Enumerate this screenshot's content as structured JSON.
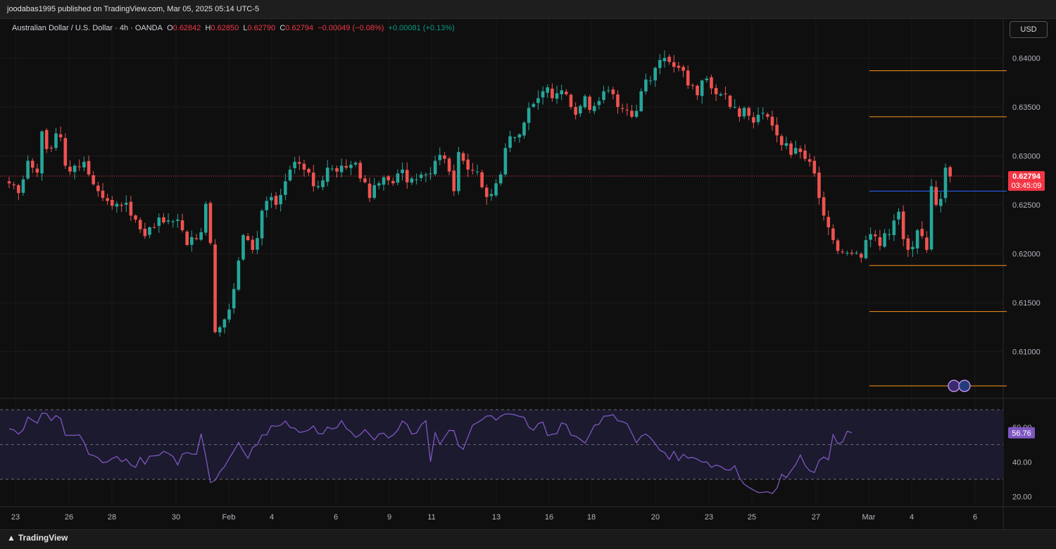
{
  "header": {
    "publisher_line": "joodabas1995 published on TradingView.com, Mar 05, 2025 05:14 UTC-5"
  },
  "legend": {
    "symbol": "Australian Dollar / U.S. Dollar · 4h · OANDA",
    "o_label": "O",
    "o_value": "0.62842",
    "h_label": "H",
    "h_value": "0.62850",
    "l_label": "L",
    "l_value": "0.62790",
    "c_label": "C",
    "c_value": "0.62794",
    "change": "−0.00049 (−0.08%)",
    "change2": "+0.00081 (+0.13%)"
  },
  "currency_button": "USD",
  "footer": {
    "logo_text": "TradingView"
  },
  "colors": {
    "up": "#26a69a",
    "down": "#ef5350",
    "background": "#0f0f0f",
    "hline_orange": "#f7931a",
    "hline_blue": "#2962ff",
    "rsi_line": "#7e57c2",
    "rsi_band": "#1c1a2e",
    "price_tag": "#f23645",
    "rsi_tag": "#7e57c2"
  },
  "chart_data": [
    {
      "type": "candlestick",
      "title": "Australian Dollar / U.S. Dollar · 4h · OANDA",
      "y_ticks": [
        "0.64000",
        "0.63500",
        "0.63000",
        "0.62500",
        "0.62000",
        "0.61500",
        "0.61000"
      ],
      "ylim": [
        0.6058,
        0.6419
      ],
      "x_ticks": [
        "23",
        "26",
        "28",
        "30",
        "Feb",
        "4",
        "6",
        "9",
        "11",
        "13",
        "16",
        "18",
        "20",
        "23",
        "25",
        "27",
        "Mar",
        "4",
        "6"
      ],
      "current_price": "0.62794",
      "countdown": "03:45:09",
      "horizontal_levels": [
        {
          "price": 0.6387,
          "color": "orange"
        },
        {
          "price": 0.634,
          "color": "orange"
        },
        {
          "price": 0.6264,
          "color": "blue"
        },
        {
          "price": 0.6188,
          "color": "orange"
        },
        {
          "price": 0.6141,
          "color": "orange"
        },
        {
          "price": 0.6065,
          "color": "orange"
        }
      ],
      "close_series": [
        0.6272,
        0.627,
        0.6262,
        0.6276,
        0.6295,
        0.6288,
        0.6283,
        0.6325,
        0.6307,
        0.6308,
        0.6323,
        0.6319,
        0.629,
        0.6284,
        0.629,
        0.6289,
        0.6294,
        0.6281,
        0.6271,
        0.6264,
        0.6257,
        0.6254,
        0.6249,
        0.6251,
        0.6249,
        0.6252,
        0.6239,
        0.6235,
        0.6225,
        0.6218,
        0.6227,
        0.6227,
        0.6237,
        0.6232,
        0.6234,
        0.6233,
        0.6235,
        0.6224,
        0.6209,
        0.6217,
        0.6215,
        0.6222,
        0.6251,
        0.6211,
        0.612,
        0.6125,
        0.6133,
        0.6143,
        0.6164,
        0.6193,
        0.6219,
        0.6214,
        0.6204,
        0.6216,
        0.6244,
        0.6254,
        0.6258,
        0.625,
        0.626,
        0.6274,
        0.6286,
        0.6294,
        0.6292,
        0.6286,
        0.6283,
        0.6269,
        0.6269,
        0.6275,
        0.6288,
        0.6287,
        0.6284,
        0.629,
        0.6288,
        0.6291,
        0.6293,
        0.6277,
        0.6273,
        0.6257,
        0.627,
        0.6272,
        0.6278,
        0.6275,
        0.6272,
        0.6282,
        0.6286,
        0.6273,
        0.6277,
        0.6276,
        0.6281,
        0.6281,
        0.6282,
        0.6295,
        0.6301,
        0.6297,
        0.6284,
        0.6264,
        0.6304,
        0.6295,
        0.6286,
        0.6285,
        0.6284,
        0.6268,
        0.6258,
        0.6261,
        0.6272,
        0.6281,
        0.6308,
        0.632,
        0.6319,
        0.6322,
        0.6334,
        0.6349,
        0.6353,
        0.6359,
        0.6366,
        0.637,
        0.6359,
        0.6364,
        0.6367,
        0.6363,
        0.635,
        0.6342,
        0.6351,
        0.6361,
        0.6347,
        0.6351,
        0.6356,
        0.6366,
        0.6367,
        0.6363,
        0.635,
        0.6348,
        0.6347,
        0.634,
        0.6346,
        0.6366,
        0.6378,
        0.6377,
        0.639,
        0.6398,
        0.64,
        0.6396,
        0.6391,
        0.639,
        0.6387,
        0.6372,
        0.6372,
        0.6362,
        0.6377,
        0.6379,
        0.6369,
        0.6363,
        0.6363,
        0.6363,
        0.635,
        0.635,
        0.634,
        0.6349,
        0.6341,
        0.6334,
        0.6342,
        0.6344,
        0.634,
        0.6331,
        0.6321,
        0.6311,
        0.6313,
        0.6301,
        0.6308,
        0.6304,
        0.6297,
        0.6294,
        0.6282,
        0.6257,
        0.6239,
        0.6227,
        0.6214,
        0.6203,
        0.6202,
        0.6201,
        0.62,
        0.6201,
        0.6196,
        0.6214,
        0.622,
        0.6218,
        0.6208,
        0.6221,
        0.622,
        0.6234,
        0.6243,
        0.6215,
        0.6204,
        0.6207,
        0.6224,
        0.6218,
        0.6204,
        0.6269,
        0.625,
        0.6256,
        0.6288,
        0.6279
      ]
    },
    {
      "type": "line",
      "title": "RSI",
      "y_ticks": [
        "60.00",
        "40.00",
        "20.00"
      ],
      "ylim": [
        15,
        72.5
      ],
      "band": [
        30,
        70
      ],
      "midline": 50,
      "current_value": "56.76",
      "values": [
        59.1,
        58.4,
        56.0,
        58.4,
        65.8,
        63.9,
        62.3,
        68.1,
        67.8,
        63.8,
        66.7,
        64.9,
        55.3,
        55.3,
        55.3,
        55.6,
        51.3,
        44.4,
        43.7,
        42.3,
        39.5,
        40.1,
        42.0,
        43.1,
        40.2,
        41.6,
        38.2,
        36.9,
        42.6,
        38.7,
        43.3,
        43.5,
        43.8,
        46.1,
        44.9,
        43.1,
        38.3,
        44.5,
        45.4,
        44.5,
        44.4,
        56.2,
        43.0,
        28.1,
        29.4,
        34.3,
        37.3,
        42.1,
        46.4,
        51.2,
        46.2,
        42.1,
        48.3,
        49.9,
        55.5,
        55.5,
        60.8,
        60.5,
        61.1,
        63.5,
        59.9,
        59.4,
        57.0,
        57.4,
        58.4,
        60.7,
        56.3,
        56.1,
        60.1,
        58.9,
        59.8,
        63.7,
        59.3,
        57.3,
        54.1,
        55.7,
        58.6,
        55.7,
        52.6,
        56.1,
        56.6,
        53.8,
        55.4,
        58.3,
        63.6,
        61.5,
        56.0,
        56.6,
        61.3,
        63.7,
        40.1,
        56.8,
        50.1,
        54.2,
        58.2,
        58.0,
        49.3,
        47.3,
        54.4,
        61.2,
        62.6,
        64.3,
        66.4,
        66.6,
        64.0,
        66.3,
        67.6,
        67.6,
        67.1,
        66.2,
        65.6,
        59.9,
        58.2,
        62.0,
        62.9,
        55.1,
        55.9,
        56.3,
        62.5,
        61.5,
        55.4,
        54.8,
        53.0,
        50.8,
        55.7,
        61.1,
        61.7,
        66.3,
        66.5,
        67.2,
        63.7,
        63.2,
        61.9,
        56.5,
        51.0,
        54.8,
        56.0,
        53.8,
        50.5,
        46.7,
        45.4,
        41.4,
        46.1,
        40.8,
        44.4,
        42.2,
        42.6,
        41.5,
        39.9,
        40.0,
        36.9,
        38.2,
        37.4,
        35.5,
        35.3,
        37.8,
        30.9,
        27.2,
        25.4,
        23.8,
        22.4,
        22.5,
        22.9,
        21.8,
        24.9,
        32.9,
        30.9,
        34.8,
        38.4,
        44.0,
        38.1,
        34.9,
        33.9,
        40.8,
        42.8,
        41.2,
        55.7,
        50.4,
        51.4,
        57.6,
        56.8
      ]
    }
  ]
}
